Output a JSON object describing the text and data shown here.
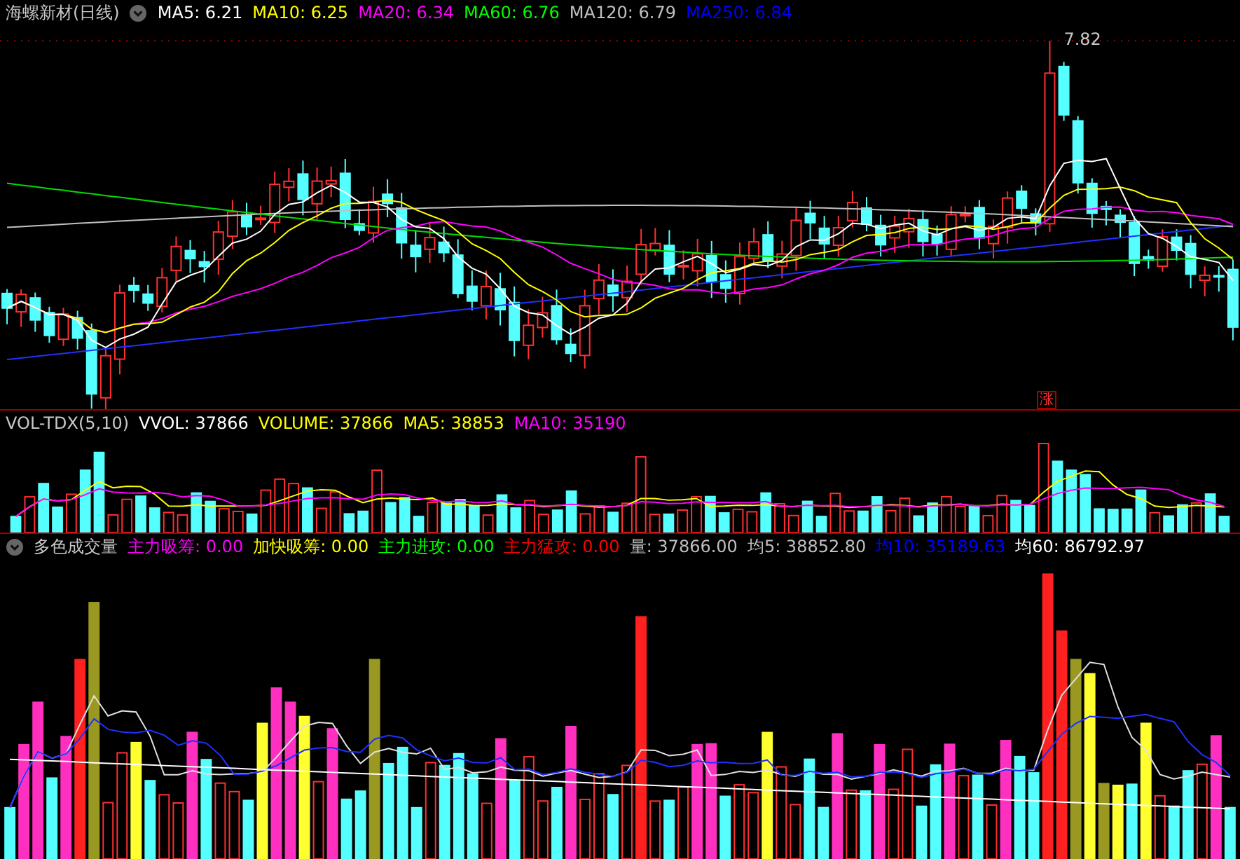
{
  "main_panel": {
    "title": "海螺新材(日线)",
    "indicators": [
      {
        "label": "MA5: 6.21",
        "color": "#ffffff"
      },
      {
        "label": "MA10: 6.25",
        "color": "#ffff00"
      },
      {
        "label": "MA20: 6.34",
        "color": "#ff00ff"
      },
      {
        "label": "MA60: 6.76",
        "color": "#00ff00"
      },
      {
        "label": "MA120: 6.79",
        "color": "#c0c0c0"
      },
      {
        "label": "MA250: 6.84",
        "color": "#0000ff"
      }
    ],
    "high_label": "7.82",
    "marker": "涨"
  },
  "volume_panel": {
    "title": "VOL-TDX(5,10)",
    "indicators": [
      {
        "label": "VVOL: 37866",
        "color": "#ffffff"
      },
      {
        "label": "VOLUME: 37866",
        "color": "#ffff00"
      },
      {
        "label": "MA5: 38853",
        "color": "#ffff00"
      },
      {
        "label": "MA10: 35190",
        "color": "#ff00ff"
      }
    ]
  },
  "color_volume_panel": {
    "title": "多色成交量",
    "indicators": [
      {
        "label": "主力吸筹: 0.00",
        "color": "#ff00ff"
      },
      {
        "label": "加快吸筹: 0.00",
        "color": "#ffff00"
      },
      {
        "label": "主力进攻: 0.00",
        "color": "#00ff00"
      },
      {
        "label": "主力猛攻: 0.00",
        "color": "#ff0000"
      },
      {
        "label": "量: 37866.00",
        "color": "#c0c0c0"
      },
      {
        "label": "均5: 38852.80",
        "color": "#c0c0c0"
      },
      {
        "label": "均10: 35189.63",
        "color": "#0000ff"
      },
      {
        "label": "均60: 86792.97",
        "color": "#ffffff"
      }
    ]
  }
}
